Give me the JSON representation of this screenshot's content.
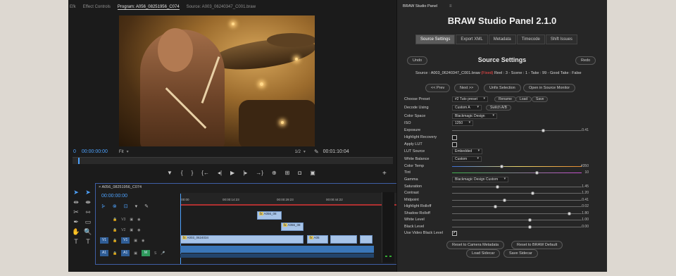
{
  "tabs": [
    "Effect Controls",
    "Program: A056_08251956_C074",
    "Source: A003_06240347_C001.braw"
  ],
  "tabs_prefix": "Efk",
  "program": {
    "timecode_left": "00:00:00:00",
    "fit_label": "Fit",
    "scale_label": "1/2",
    "timecode_right": "00:01:10:04"
  },
  "transport_icons": [
    "marker-icon",
    "in-point-icon",
    "out-point-icon",
    "go-to-in-icon",
    "step-back-icon",
    "play-icon",
    "step-forward-icon",
    "go-to-out-icon",
    "insert-icon",
    "overwrite-icon",
    "export-frame-icon",
    "comparison-icon"
  ],
  "timeline": {
    "sequence_name": "A056_08251956_C074",
    "timecode": "00:00:00:00",
    "ruler_labels": [
      ":00:00",
      "00:00:14:23",
      "00:00:29:23",
      "00:00:44:22"
    ],
    "tracks": [
      {
        "name": "V3"
      },
      {
        "name": "V2"
      },
      {
        "name": "V1"
      },
      {
        "name": "A1"
      }
    ],
    "video_clips": [
      "A056_08",
      "A056_08",
      "A003_0624034",
      "A05"
    ],
    "v1_marker": "fx"
  },
  "panel": {
    "window_title": "BRAW Studio Panel",
    "title": "BRAW Studio Panel 2.1.0",
    "tabs": [
      "Source Settings",
      "Export XML",
      "Metadata",
      "Timecode",
      "Shift Issues"
    ],
    "undo": "Undo",
    "redo": "Redo",
    "section_title": "Source Settings",
    "source_label": "Source : A003_06240347_C001.braw",
    "fixed_label": "(Fixed)",
    "source_meta": "Reel : 3 - Scene : 1 - Take : 99 - Good Take : False",
    "nav_buttons": [
      "<< Prev",
      "Next >>",
      "Unfix Selection",
      "Open in Source Monitor"
    ],
    "preset": {
      "label": "Choose Preset",
      "value": "#2 Tuto preset",
      "rename": "Rename",
      "load": "Load",
      "save": "Save"
    },
    "decode": {
      "label": "Decode Using",
      "value": "Custom A",
      "switch": "Switch A/B"
    },
    "colorspace": {
      "label": "Color Space",
      "value": "Blackmagic Design"
    },
    "iso": {
      "label": "ISO",
      "value": "1250"
    },
    "exposure": {
      "label": "Exposure",
      "value": "0.41",
      "level": 0.7
    },
    "highlight_recovery": {
      "label": "Highlight Recovery",
      "checked": false
    },
    "apply_lut": {
      "label": "Apply LUT",
      "checked": false
    },
    "lut_source": {
      "label": "LUT Source",
      "value": "Embedded"
    },
    "white_balance": {
      "label": "White Balance",
      "value": "Custom"
    },
    "color_temp": {
      "label": "Color Temp",
      "value": "4350",
      "level": 0.38
    },
    "tint": {
      "label": "Tint",
      "value": "10",
      "level": 0.65
    },
    "gamma": {
      "label": "Gamma",
      "value": "Blackmagic Design Custom"
    },
    "saturation": {
      "label": "Saturation",
      "value": "1.45",
      "level": 0.35
    },
    "contrast": {
      "label": "Contrast",
      "value": "1.20",
      "level": 0.62
    },
    "midpoint": {
      "label": "Midpoint",
      "value": "0.41",
      "level": 0.4
    },
    "highlight_rolloff": {
      "label": "Highlight Rolloff",
      "value": "0.02",
      "level": 0.33
    },
    "shadow_rolloff": {
      "label": "Shadow Rolloff",
      "value": "1.80",
      "level": 0.9
    },
    "white_level": {
      "label": "White Level",
      "value": "1.00",
      "level": 0.6
    },
    "black_level": {
      "label": "Black Level",
      "value": "0.00",
      "level": 0.6
    },
    "use_video_black": {
      "label": "Use Video Black Level",
      "checked": true
    },
    "reset_camera": "Reset to Camera Metadata",
    "reset_braw": "Reset to BRAW Default",
    "load_sidecar": "Load Sidecar",
    "save_sidecar": "Save Sidecar"
  }
}
